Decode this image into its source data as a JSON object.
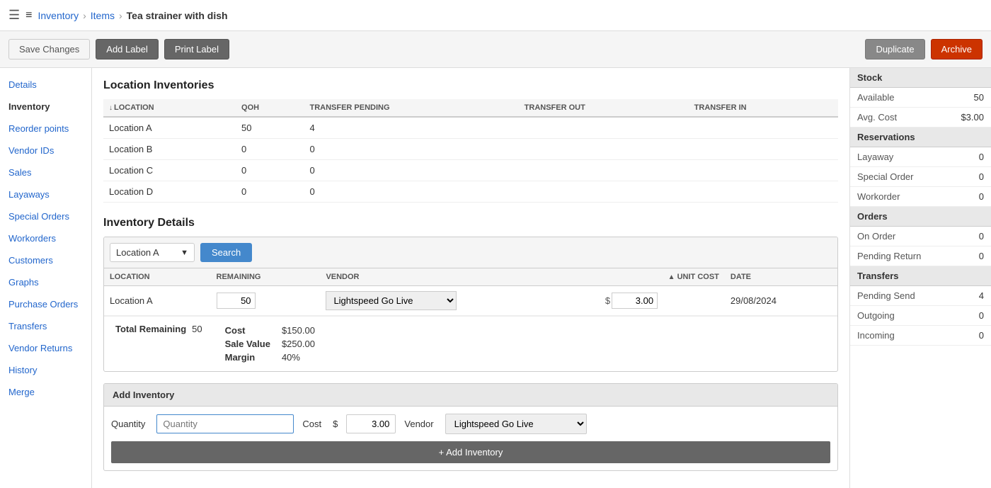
{
  "topbar": {
    "menu_icon": "☰",
    "breadcrumb_icon": "≡",
    "nav1": "Inventory",
    "nav2": "Items",
    "current": "Tea strainer with dish"
  },
  "actionbar": {
    "save_changes": "Save Changes",
    "add_label": "Add Label",
    "print_label": "Print Label",
    "duplicate": "Duplicate",
    "archive": "Archive"
  },
  "sidebar": {
    "items": [
      {
        "id": "details",
        "label": "Details",
        "active": false
      },
      {
        "id": "inventory",
        "label": "Inventory",
        "active": true
      },
      {
        "id": "reorder-points",
        "label": "Reorder points",
        "active": false
      },
      {
        "id": "vendor-ids",
        "label": "Vendor IDs",
        "active": false
      },
      {
        "id": "sales",
        "label": "Sales",
        "active": false
      },
      {
        "id": "layaways",
        "label": "Layaways",
        "active": false
      },
      {
        "id": "special-orders",
        "label": "Special Orders",
        "active": false
      },
      {
        "id": "workorders",
        "label": "Workorders",
        "active": false
      },
      {
        "id": "customers",
        "label": "Customers",
        "active": false
      },
      {
        "id": "graphs",
        "label": "Graphs",
        "active": false
      },
      {
        "id": "purchase-orders",
        "label": "Purchase Orders",
        "active": false
      },
      {
        "id": "transfers",
        "label": "Transfers",
        "active": false
      },
      {
        "id": "vendor-returns",
        "label": "Vendor Returns",
        "active": false
      },
      {
        "id": "history",
        "label": "History",
        "active": false
      },
      {
        "id": "merge",
        "label": "Merge",
        "active": false
      }
    ]
  },
  "location_inventories": {
    "title": "Location Inventories",
    "columns": [
      "LOCATION",
      "QOH",
      "TRANSFER PENDING",
      "TRANSFER OUT",
      "TRANSFER IN"
    ],
    "rows": [
      {
        "location": "Location A",
        "qoh": "50",
        "transfer_pending": "4",
        "transfer_out": "",
        "transfer_in": ""
      },
      {
        "location": "Location B",
        "qoh": "0",
        "transfer_pending": "0",
        "transfer_out": "",
        "transfer_in": ""
      },
      {
        "location": "Location C",
        "qoh": "0",
        "transfer_pending": "0",
        "transfer_out": "",
        "transfer_in": ""
      },
      {
        "location": "Location D",
        "qoh": "0",
        "transfer_pending": "0",
        "transfer_out": "",
        "transfer_in": ""
      }
    ]
  },
  "inventory_details": {
    "title": "Inventory Details",
    "search_location": "Location A",
    "search_btn": "Search",
    "columns": [
      "LOCATION",
      "REMAINING",
      "VENDOR",
      "UNIT COST",
      "DATE"
    ],
    "row": {
      "location": "Location A",
      "remaining": "50",
      "vendor": "Lightspeed Go Live",
      "unit_cost": "3.00",
      "date": "29/08/2024"
    },
    "summary": {
      "total_remaining_label": "Total Remaining",
      "total_remaining": "50",
      "cost_label": "Cost",
      "cost": "$150.00",
      "sale_value_label": "Sale Value",
      "sale_value": "$250.00",
      "margin_label": "Margin",
      "margin": "40%"
    },
    "vendor_options": [
      "Lightspeed Go Live"
    ]
  },
  "add_inventory": {
    "header": "Add Inventory",
    "quantity_label": "Quantity",
    "quantity_placeholder": "Quantity",
    "cost_label": "Cost",
    "cost_dollar": "$",
    "cost_value": "3.00",
    "vendor_label": "Vendor",
    "vendor_value": "Lightspeed Go Live",
    "vendor_options": [
      "Lightspeed Go Live"
    ],
    "add_btn": "+ Add Inventory"
  },
  "right_panel": {
    "stock": {
      "header": "Stock",
      "available_label": "Available",
      "available_value": "50",
      "avg_cost_label": "Avg. Cost",
      "avg_cost_value": "$3.00"
    },
    "reservations": {
      "header": "Reservations",
      "layaway_label": "Layaway",
      "layaway_value": "0",
      "special_order_label": "Special Order",
      "special_order_value": "0",
      "workorder_label": "Workorder",
      "workorder_value": "0"
    },
    "orders": {
      "header": "Orders",
      "on_order_label": "On Order",
      "on_order_value": "0",
      "pending_return_label": "Pending Return",
      "pending_return_value": "0"
    },
    "transfers": {
      "header": "Transfers",
      "pending_send_label": "Pending Send",
      "pending_send_value": "4",
      "outgoing_label": "Outgoing",
      "outgoing_value": "0",
      "incoming_label": "Incoming",
      "incoming_value": "0"
    }
  }
}
